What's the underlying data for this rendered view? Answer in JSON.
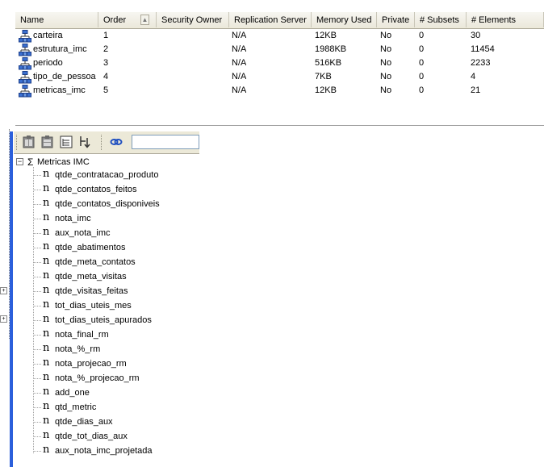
{
  "table": {
    "columns": [
      "Name",
      "Order",
      "Security Owner",
      "Replication Server",
      "Memory Used",
      "Private",
      "# Subsets",
      "# Elements"
    ],
    "rows": [
      {
        "name": "carteira",
        "order": "1",
        "security_owner": "",
        "replication_server": "N/A",
        "memory_used": "12KB",
        "private": "No",
        "subsets": "0",
        "elements": "30"
      },
      {
        "name": "estrutura_imc",
        "order": "2",
        "security_owner": "",
        "replication_server": "N/A",
        "memory_used": "1988KB",
        "private": "No",
        "subsets": "0",
        "elements": "11454"
      },
      {
        "name": "periodo",
        "order": "3",
        "security_owner": "",
        "replication_server": "N/A",
        "memory_used": "516KB",
        "private": "No",
        "subsets": "0",
        "elements": "2233"
      },
      {
        "name": "tipo_de_pessoa",
        "order": "4",
        "security_owner": "",
        "replication_server": "N/A",
        "memory_used": "7KB",
        "private": "No",
        "subsets": "0",
        "elements": "4"
      },
      {
        "name": "metricas_imc",
        "order": "5",
        "security_owner": "",
        "replication_server": "N/A",
        "memory_used": "12KB",
        "private": "No",
        "subsets": "0",
        "elements": "21"
      }
    ],
    "sort_indicator": "▲"
  },
  "toolbar": {
    "search_value": "",
    "icons": [
      "dimension-a-icon",
      "dimension-b-icon",
      "tree-view-icon",
      "sort-hierarchy-icon",
      "link-icon"
    ]
  },
  "tree": {
    "root_toggle": "−",
    "root_symbol": "Σ",
    "root_label": "Metricas IMC",
    "item_symbol": "n",
    "items": [
      "qtde_contratacao_produto",
      "qtde_contatos_feitos",
      "qtde_contatos_disponiveis",
      "nota_imc",
      "aux_nota_imc",
      "qtde_abatimentos",
      "qtde_meta_contatos",
      "qtde_meta_visitas",
      "qtde_visitas_feitas",
      "tot_dias_uteis_mes",
      "tot_dias_uteis_apurados",
      "nota_final_rm",
      "nota_%_rm",
      "nota_projecao_rm",
      "nota_%_projecao_rm",
      "add_one",
      "qtd_metric",
      "qtde_dias_aux",
      "qtde_tot_dias_aux",
      "aux_nota_imc_projetada"
    ]
  },
  "colors": {
    "accent_bar": "#2b5fdb",
    "header_bg": "#ece9d8"
  }
}
